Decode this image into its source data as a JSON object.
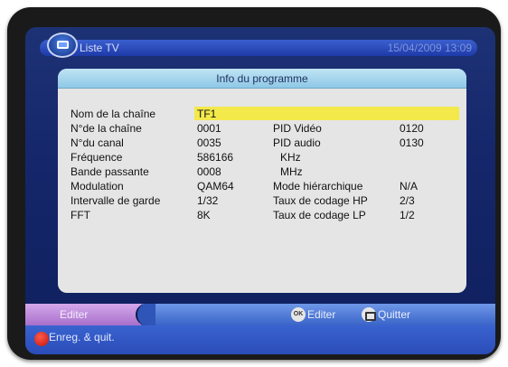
{
  "header": {
    "title": "Liste TV",
    "datetime": "15/04/2009 13:09",
    "icon": "tv-icon"
  },
  "panel": {
    "title": "Info du programme",
    "rows": [
      {
        "label": "Nom de la chaîne",
        "value": "TF1"
      },
      {
        "label": "N°de la chaîne",
        "value": "0001",
        "label2": "PID Vidéo",
        "value2": "0120"
      },
      {
        "label": "N°du canal",
        "value": "0035",
        "label2": "PID audio",
        "value2": "0130"
      },
      {
        "label": "Fréquence",
        "value": "586166",
        "unit": "KHz"
      },
      {
        "label": "Bande passante",
        "value": "0008",
        "unit": "MHz"
      },
      {
        "label": "Modulation",
        "value": "QAM64",
        "label2": "Mode hiérarchique",
        "value2": "N/A"
      },
      {
        "label": "Intervalle de garde",
        "value": "1/32",
        "label2": "Taux de codage HP",
        "value2": "2/3"
      },
      {
        "label": "FFT",
        "value": "8K",
        "label2": "Taux de codage LP",
        "value2": "1/2"
      }
    ],
    "highlight_color": "#f3e94a"
  },
  "footer": {
    "edit_tab": "Editer",
    "ok_icon_text": "OK",
    "ok_label": "Editer",
    "exit_label": "Quitter",
    "save_label": "Enreg. & quit."
  }
}
